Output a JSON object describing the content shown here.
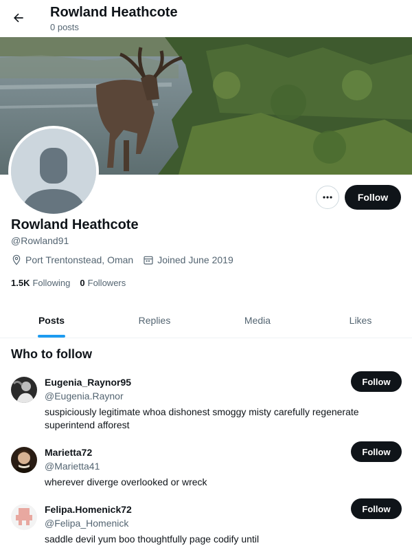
{
  "header": {
    "title": "Rowland Heathcote",
    "post_count": "0 posts"
  },
  "profile": {
    "name": "Rowland Heathcote",
    "handle": "@Rowland91",
    "location": "Port Trentonstead, Oman",
    "joined": "Joined June 2019",
    "following_count": "1.5K",
    "following_label": "Following",
    "followers_count": "0",
    "followers_label": "Followers",
    "follow_label": "Follow"
  },
  "tabs": [
    {
      "label": "Posts",
      "active": true
    },
    {
      "label": "Replies",
      "active": false
    },
    {
      "label": "Media",
      "active": false
    },
    {
      "label": "Likes",
      "active": false
    }
  ],
  "who_to_follow": {
    "title": "Who to follow",
    "users": [
      {
        "name": "Eugenia_Raynor95",
        "handle": "@Eugenia.Raynor",
        "bio": "suspiciously legitimate whoa dishonest smoggy misty carefully regenerate superintend afforest",
        "follow_label": "Follow"
      },
      {
        "name": "Marietta72",
        "handle": "@Marietta41",
        "bio": "wherever diverge overlooked or wreck",
        "follow_label": "Follow"
      },
      {
        "name": "Felipa.Homenick72",
        "handle": "@Felipa_Homenick",
        "bio": "saddle devil yum boo thoughtfully page codify until",
        "follow_label": "Follow"
      }
    ]
  },
  "icons": {
    "back": "arrow-left-icon",
    "more": "more-dots-icon",
    "location": "location-pin-icon",
    "calendar": "calendar-icon"
  },
  "colors": {
    "accent": "#1d9bf0",
    "button": "#0f1419",
    "muted": "#536471"
  }
}
